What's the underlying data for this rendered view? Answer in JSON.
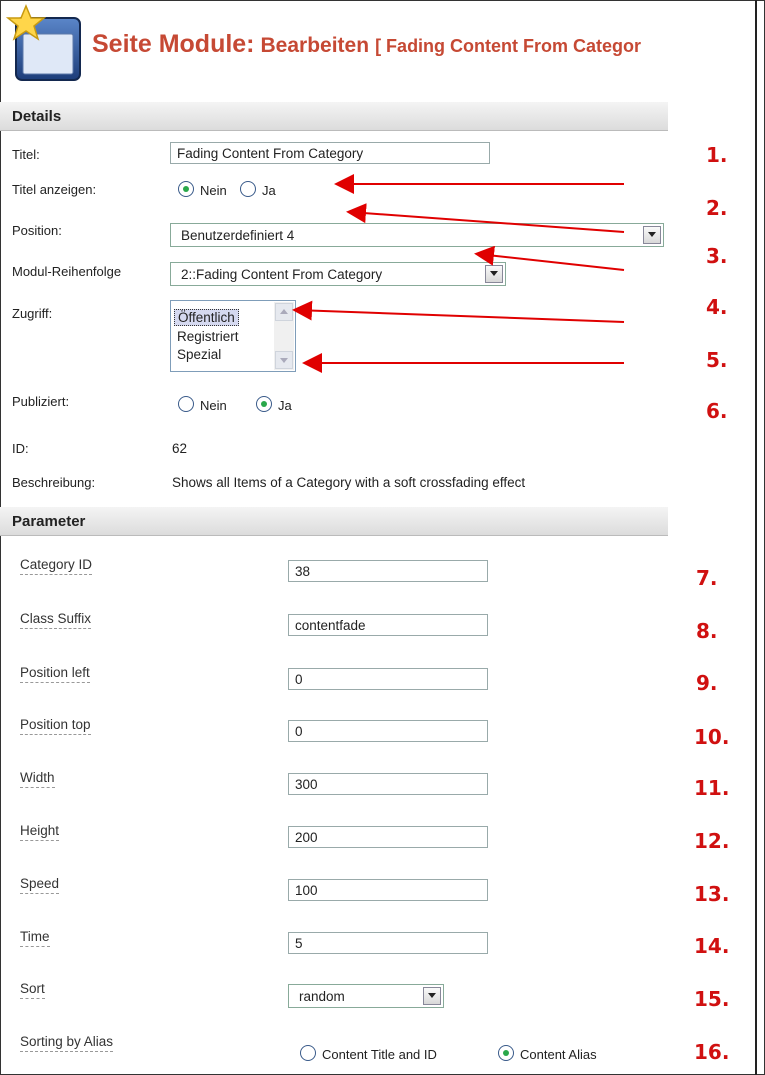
{
  "header": {
    "title_main": "Seite Module:",
    "title_action": "Bearbeiten",
    "title_item": "[ Fading Content From Categor"
  },
  "details": {
    "section_label": "Details",
    "title_label": "Titel:",
    "title_value": "Fading Content From Category",
    "show_title_label": "Titel anzeigen:",
    "show_title_options": [
      "Nein",
      "Ja"
    ],
    "show_title_selected": "Nein",
    "position_label": "Position:",
    "position_value": "Benutzerdefiniert 4",
    "order_label": "Modul-Reihenfolge",
    "order_value": "2::Fading Content From Category",
    "access_label": "Zugriff:",
    "access_options": [
      "Öffentlich",
      "Registriert",
      "Spezial"
    ],
    "access_selected": "Öffentlich",
    "published_label": "Publiziert:",
    "published_options": [
      "Nein",
      "Ja"
    ],
    "published_selected": "Ja",
    "id_label": "ID:",
    "id_value": "62",
    "description_label": "Beschreibung:",
    "description_value": "Shows all Items of a Category with a soft crossfading effect"
  },
  "parameters": {
    "section_label": "Parameter",
    "category_id_label": "Category ID",
    "category_id_value": "38",
    "class_suffix_label": "Class Suffix",
    "class_suffix_value": "contentfade",
    "position_left_label": "Position left",
    "position_left_value": "0",
    "position_top_label": "Position top",
    "position_top_value": "0",
    "width_label": "Width",
    "width_value": "300",
    "height_label": "Height",
    "height_value": "200",
    "speed_label": "Speed",
    "speed_value": "100",
    "time_label": "Time",
    "time_value": "5",
    "sort_label": "Sort",
    "sort_value": "random",
    "sorting_alias_label": "Sorting by Alias",
    "sorting_alias_options": [
      "Content Title and ID",
      "Content Alias"
    ],
    "sorting_alias_selected": "Content Alias"
  },
  "callouts": [
    "1.",
    "2.",
    "3.",
    "4.",
    "5.",
    "6.",
    "7.",
    "8.",
    "9.",
    "10.",
    "11.",
    "12.",
    "13.",
    "14.",
    "15.",
    "16."
  ],
  "colors": {
    "title_red": "#c64934",
    "callout_red": "#d01010",
    "radio_checked": "#2aa84a"
  },
  "icons": {
    "logo": "module-window-star-icon",
    "dropdown": "chevron-down-icon"
  }
}
